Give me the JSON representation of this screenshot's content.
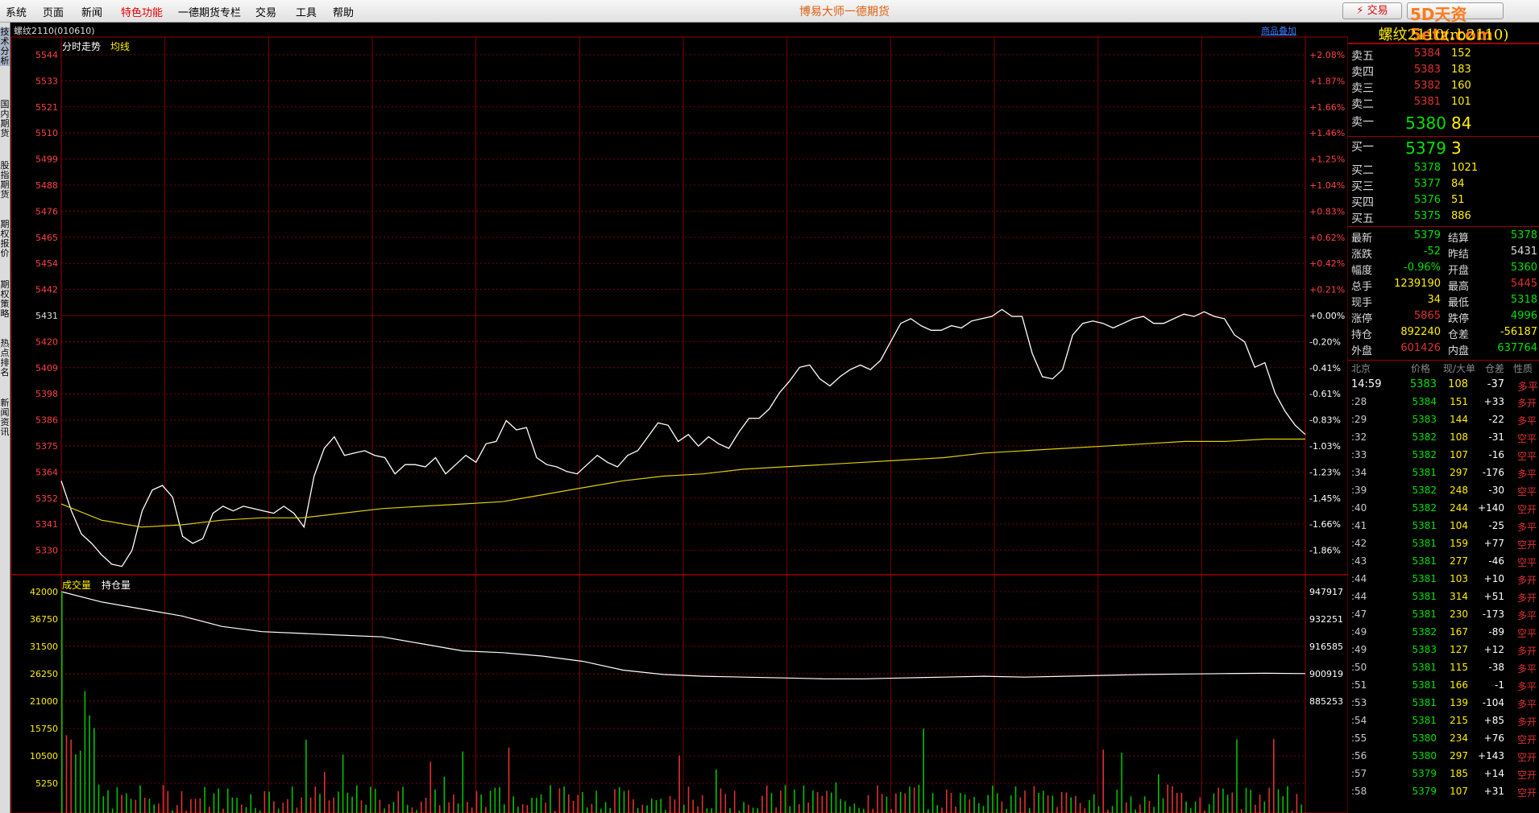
{
  "menu": [
    "系统",
    "页面",
    "新闻",
    "特色功能",
    "一德期货专栏",
    "交易",
    "工具",
    "帮助"
  ],
  "app_title": "博易大师一德期货",
  "trade_button": "⚡ 交易",
  "watermark": "5D天资5etz.com",
  "side_tabs": [
    "技术分析",
    "国内期货",
    "股指期货",
    "期权报价",
    "期权策略",
    "热点排名",
    "新闻资讯"
  ],
  "chart": {
    "symbol": "螺纹2110(010610)",
    "add_product": "商品叠加",
    "tab_price": "分时走势",
    "tab_avg": "均线",
    "tab_volume": "成交量",
    "tab_oi": "持仓量"
  },
  "chart_data": {
    "type": "line",
    "title": "螺纹2110 分时走势",
    "price_axis": [
      "5544",
      "5533",
      "5521",
      "5510",
      "5499",
      "5488",
      "5476",
      "5465",
      "5454",
      "5442",
      "5431",
      "5420",
      "5409",
      "5398",
      "5386",
      "5375",
      "5364",
      "5352",
      "5341",
      "5330"
    ],
    "pct_axis": [
      "+2.08%",
      "+1.87%",
      "+1.66%",
      "+1.46%",
      "+1.25%",
      "+1.04%",
      "+0.83%",
      "+0.62%",
      "+0.42%",
      "+0.21%",
      "+0.00%",
      "-0.20%",
      "-0.41%",
      "-0.61%",
      "-0.83%",
      "-1.03%",
      "-1.23%",
      "-1.45%",
      "-1.66%",
      "-1.86%"
    ],
    "vol_axis": [
      "42000",
      "36750",
      "31500",
      "26250",
      "21000",
      "15750",
      "10500",
      "5250"
    ],
    "oi_axis": [
      "947917",
      "932251",
      "916585",
      "900919",
      "885253"
    ],
    "ylim": [
      5330,
      5544
    ],
    "prev_settle": 5431,
    "price": [
      5360,
      5347,
      5337,
      5333,
      5328,
      5324,
      5323,
      5330,
      5347,
      5356,
      5358,
      5353,
      5336,
      5333,
      5335,
      5346,
      5349,
      5347,
      5349,
      5348,
      5347,
      5346,
      5349,
      5346,
      5340,
      5362,
      5374,
      5379,
      5371,
      5372,
      5373,
      5371,
      5370,
      5363,
      5367,
      5367,
      5366,
      5370,
      5363,
      5367,
      5371,
      5368,
      5376,
      5377,
      5386,
      5382,
      5383,
      5370,
      5367,
      5366,
      5364,
      5363,
      5367,
      5371,
      5368,
      5366,
      5371,
      5373,
      5379,
      5385,
      5384,
      5377,
      5380,
      5375,
      5379,
      5376,
      5374,
      5381,
      5387,
      5387,
      5391,
      5398,
      5403,
      5409,
      5410,
      5404,
      5401,
      5405,
      5408,
      5410,
      5408,
      5412,
      5420,
      5428,
      5430,
      5427,
      5425,
      5425,
      5427,
      5426,
      5429,
      5430,
      5431,
      5434,
      5431,
      5431,
      5415,
      5405,
      5404,
      5408,
      5423,
      5428,
      5429,
      5428,
      5426,
      5428,
      5430,
      5431,
      5428,
      5428,
      5430,
      5432,
      5431,
      5433,
      5431,
      5430,
      5423,
      5420,
      5409,
      5411,
      5398,
      5390,
      5384,
      5380
    ],
    "avg": [
      5350,
      5343,
      5340,
      5341,
      5343,
      5344,
      5344,
      5346,
      5348,
      5349,
      5350,
      5351,
      5354,
      5357,
      5360,
      5362,
      5363,
      5365,
      5366,
      5367,
      5368,
      5369,
      5370,
      5372,
      5373,
      5374,
      5375,
      5376,
      5377,
      5377,
      5378,
      5378
    ],
    "volume_peak": 42000,
    "oi_range": [
      885253,
      947917
    ]
  },
  "panel": {
    "title": "螺纹2110(rb2110)",
    "asks": [
      {
        "label": "卖五",
        "price": "5384",
        "vol": "152"
      },
      {
        "label": "卖四",
        "price": "5383",
        "vol": "183"
      },
      {
        "label": "卖三",
        "price": "5382",
        "vol": "160"
      },
      {
        "label": "卖二",
        "price": "5381",
        "vol": "101"
      }
    ],
    "ask1": {
      "label": "卖一",
      "price": "5380",
      "vol": "84"
    },
    "bid1": {
      "label": "买一",
      "price": "5379",
      "vol": "3"
    },
    "bids": [
      {
        "label": "买二",
        "price": "5378",
        "vol": "1021"
      },
      {
        "label": "买三",
        "price": "5377",
        "vol": "84"
      },
      {
        "label": "买四",
        "price": "5376",
        "vol": "51"
      },
      {
        "label": "买五",
        "price": "5375",
        "vol": "886"
      }
    ],
    "stats": [
      {
        "l": "最新",
        "v": "5379",
        "lc": "#00e000",
        "r": "结算",
        "rv": "5378",
        "rc": "#00e000"
      },
      {
        "l": "涨跌",
        "v": "-52",
        "lc": "#00e000",
        "r": "昨结",
        "rv": "5431",
        "rc": "#dcdcdc"
      },
      {
        "l": "幅度",
        "v": "-0.96%",
        "lc": "#00e000",
        "r": "开盘",
        "rv": "5360",
        "rc": "#00e000"
      },
      {
        "l": "总手",
        "v": "1239190",
        "lc": "#ffee00",
        "r": "最高",
        "rv": "5445",
        "rc": "#e03030"
      },
      {
        "l": "现手",
        "v": "34",
        "lc": "#ffee00",
        "r": "最低",
        "rv": "5318",
        "rc": "#00e000"
      },
      {
        "l": "涨停",
        "v": "5865",
        "lc": "#e03030",
        "r": "跌停",
        "rv": "4996",
        "rc": "#00e000"
      },
      {
        "l": "持仓",
        "v": "892240",
        "lc": "#ffee00",
        "r": "仓差",
        "rv": "-56187",
        "rc": "#ffee00"
      },
      {
        "l": "外盘",
        "v": "601426",
        "lc": "#e03030",
        "r": "内盘",
        "rv": "637764",
        "rc": "#00e000"
      }
    ],
    "tick_header": [
      "北京",
      "价格",
      "现/大单",
      "仓差",
      "性质"
    ],
    "ticks": [
      {
        "t": "14:59",
        "p": "5383",
        "v": "108",
        "d": "-37",
        "n": "多平"
      },
      {
        "t": ":28",
        "p": "5384",
        "v": "151",
        "d": "+33",
        "n": "多开"
      },
      {
        "t": ":29",
        "p": "5383",
        "v": "144",
        "d": "-22",
        "n": "多平"
      },
      {
        "t": ":32",
        "p": "5382",
        "v": "108",
        "d": "-31",
        "n": "空平"
      },
      {
        "t": ":33",
        "p": "5382",
        "v": "107",
        "d": "-16",
        "n": "空平"
      },
      {
        "t": ":34",
        "p": "5381",
        "v": "297",
        "d": "-176",
        "n": "多平"
      },
      {
        "t": ":39",
        "p": "5382",
        "v": "248",
        "d": "-30",
        "n": "空平"
      },
      {
        "t": ":40",
        "p": "5382",
        "v": "244",
        "d": "+140",
        "n": "空开"
      },
      {
        "t": ":41",
        "p": "5381",
        "v": "104",
        "d": "-25",
        "n": "多平"
      },
      {
        "t": ":42",
        "p": "5381",
        "v": "159",
        "d": "+77",
        "n": "空开"
      },
      {
        "t": ":43",
        "p": "5381",
        "v": "277",
        "d": "-46",
        "n": "空平"
      },
      {
        "t": ":44",
        "p": "5381",
        "v": "103",
        "d": "+10",
        "n": "多开"
      },
      {
        "t": ":44",
        "p": "5381",
        "v": "314",
        "d": "+51",
        "n": "多开"
      },
      {
        "t": ":47",
        "p": "5381",
        "v": "230",
        "d": "-173",
        "n": "多平"
      },
      {
        "t": ":49",
        "p": "5382",
        "v": "167",
        "d": "-89",
        "n": "空平"
      },
      {
        "t": ":49",
        "p": "5383",
        "v": "127",
        "d": "+12",
        "n": "多开"
      },
      {
        "t": ":50",
        "p": "5381",
        "v": "115",
        "d": "-38",
        "n": "多平"
      },
      {
        "t": ":51",
        "p": "5381",
        "v": "166",
        "d": "-1",
        "n": "多平"
      },
      {
        "t": ":53",
        "p": "5381",
        "v": "139",
        "d": "-104",
        "n": "多平"
      },
      {
        "t": ":54",
        "p": "5381",
        "v": "215",
        "d": "+85",
        "n": "多开"
      },
      {
        "t": ":55",
        "p": "5380",
        "v": "234",
        "d": "+76",
        "n": "空开"
      },
      {
        "t": ":56",
        "p": "5380",
        "v": "297",
        "d": "+143",
        "n": "空开"
      },
      {
        "t": ":57",
        "p": "5379",
        "v": "185",
        "d": "+14",
        "n": "空开"
      },
      {
        "t": ":58",
        "p": "5379",
        "v": "107",
        "d": "+31",
        "n": "空开"
      }
    ]
  }
}
